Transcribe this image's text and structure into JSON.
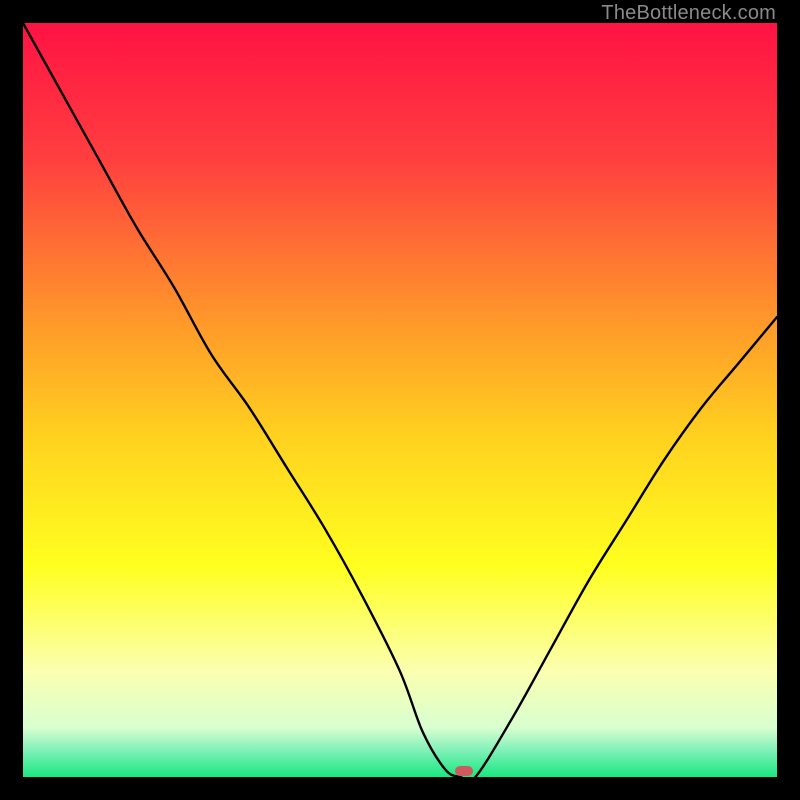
{
  "watermark": "TheBottleneck.com",
  "chart_data": {
    "type": "line",
    "title": "",
    "xlabel": "",
    "ylabel": "",
    "xlim": [
      0,
      100
    ],
    "ylim": [
      0,
      100
    ],
    "gradient_stops": [
      {
        "offset": 0,
        "color": "#ff1244"
      },
      {
        "offset": 0.18,
        "color": "#ff3f3f"
      },
      {
        "offset": 0.4,
        "color": "#ff9a2a"
      },
      {
        "offset": 0.55,
        "color": "#ffd21f"
      },
      {
        "offset": 0.72,
        "color": "#ffff1f"
      },
      {
        "offset": 0.86,
        "color": "#fbffb0"
      },
      {
        "offset": 0.935,
        "color": "#d8ffd0"
      },
      {
        "offset": 0.965,
        "color": "#7ff0b8"
      },
      {
        "offset": 1.0,
        "color": "#18e880"
      }
    ],
    "series": [
      {
        "name": "bottleneck-curve",
        "x": [
          0,
          5,
          10,
          15,
          20,
          25,
          30,
          35,
          40,
          45,
          50,
          53,
          56,
          58,
          60,
          65,
          70,
          75,
          80,
          85,
          90,
          95,
          100
        ],
        "values": [
          100,
          91,
          82,
          73,
          65,
          56,
          49,
          41,
          33,
          24,
          14,
          6,
          1,
          0,
          0,
          8,
          17,
          26,
          34,
          42,
          49,
          55,
          61
        ]
      }
    ],
    "marker": {
      "x": 58.5,
      "y": 0.8,
      "w": 2.4,
      "h": 1.3,
      "color": "#cc5a5f"
    }
  }
}
